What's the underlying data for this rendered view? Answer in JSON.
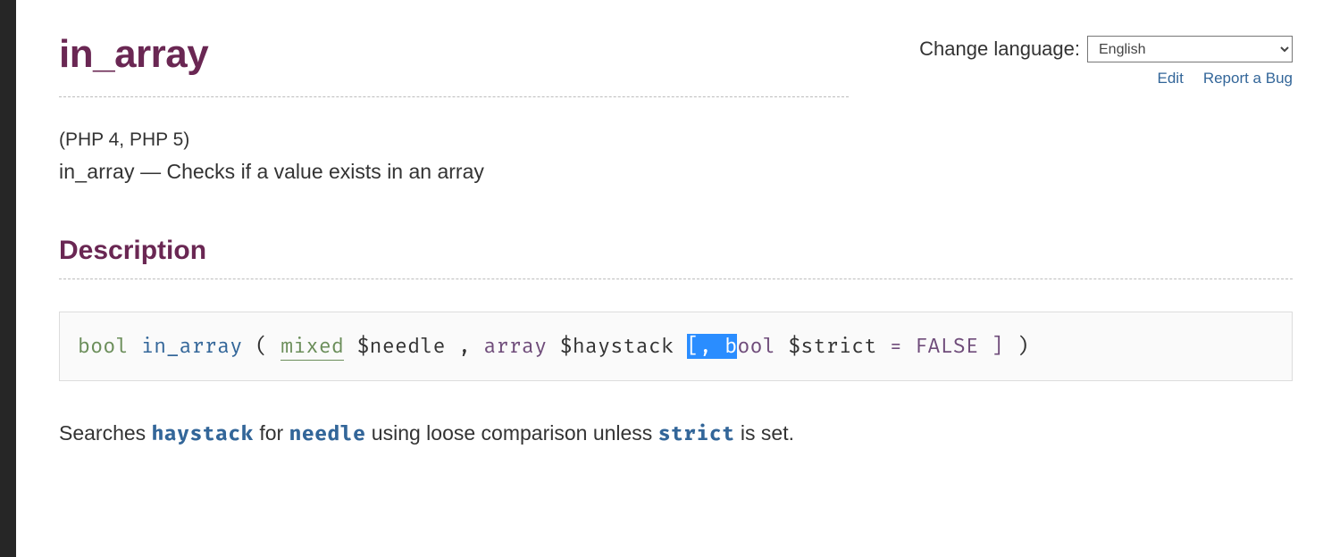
{
  "header": {
    "title": "in_array",
    "lang_label": "Change language:",
    "lang_selected": "English",
    "lang_options": [
      "English"
    ],
    "links": {
      "edit": "Edit",
      "report": "Report a Bug"
    }
  },
  "meta": {
    "versions": "(PHP 4, PHP 5)",
    "summary_name": "in_array",
    "summary_sep": " — ",
    "summary_desc": "Checks if a value exists in an array"
  },
  "sections": {
    "description": "Description"
  },
  "synopsis": {
    "ret_type": "bool",
    "fn": "in_array",
    "lp": " ( ",
    "p1_type": "mixed",
    "p1_var": "$needle",
    "c1": " , ",
    "p2_type": "array",
    "p2_var": "$haystack",
    "sp1": " ",
    "sel_part": "[, b",
    "p3_type_rest": "ool",
    "sp2": " ",
    "p3_var": "$strict",
    "eq": " = ",
    "p3_def": "FALSE",
    "opt_close": " ]",
    "rp": " )"
  },
  "body": {
    "search_para": {
      "t1": "Searches ",
      "h1": "haystack",
      "t2": " for ",
      "h2": "needle",
      "t3": " using loose comparison unless ",
      "h3": "strict",
      "t4": " is set."
    }
  }
}
